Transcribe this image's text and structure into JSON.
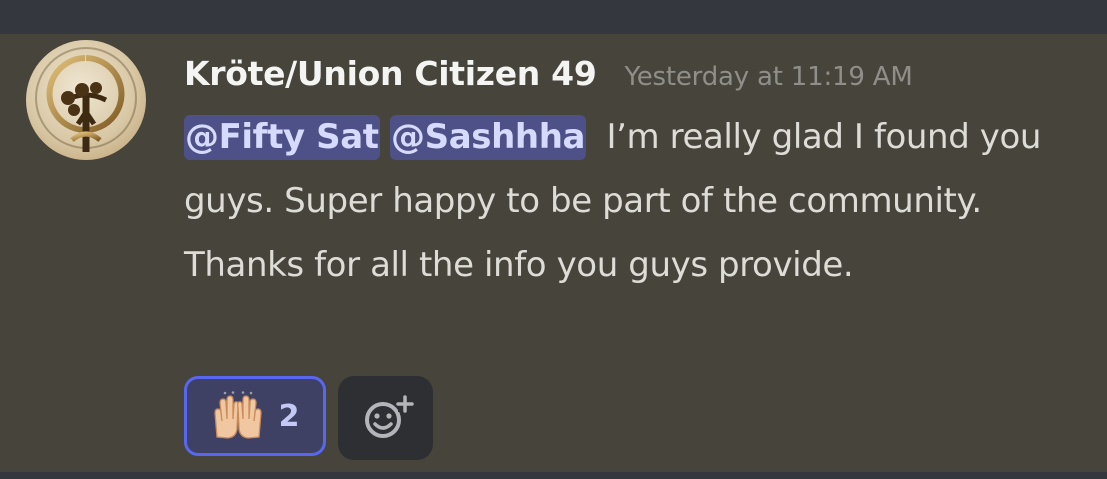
{
  "message": {
    "author": "Kröte/Union Citizen 49",
    "timestamp": "Yesterday at 11:19 AM",
    "mentions": [
      "@Fifty Sat",
      "@Sashhha"
    ],
    "text": "I’m really glad I found you guys. Super happy to be part of the community. Thanks for all the info you guys provide.",
    "avatar_icon": "tree-emblem-icon"
  },
  "reactions": [
    {
      "emoji": "🙌",
      "emoji_name": "raising-hands-icon",
      "count": "2",
      "selected": true
    }
  ],
  "add_reaction_icon": "add-reaction-smiley-icon",
  "colors": {
    "background": "#47443b",
    "frame": "#34373d",
    "username": "#f4f4f2",
    "timestamp": "#8f8e88",
    "body_text": "#dedcd6",
    "mention_bg": "#4e5187",
    "mention_text": "#d6dafc",
    "reaction_border": "#5966f0",
    "reaction_bg": "#3e4163",
    "add_reaction_bg": "#2e2f33"
  }
}
